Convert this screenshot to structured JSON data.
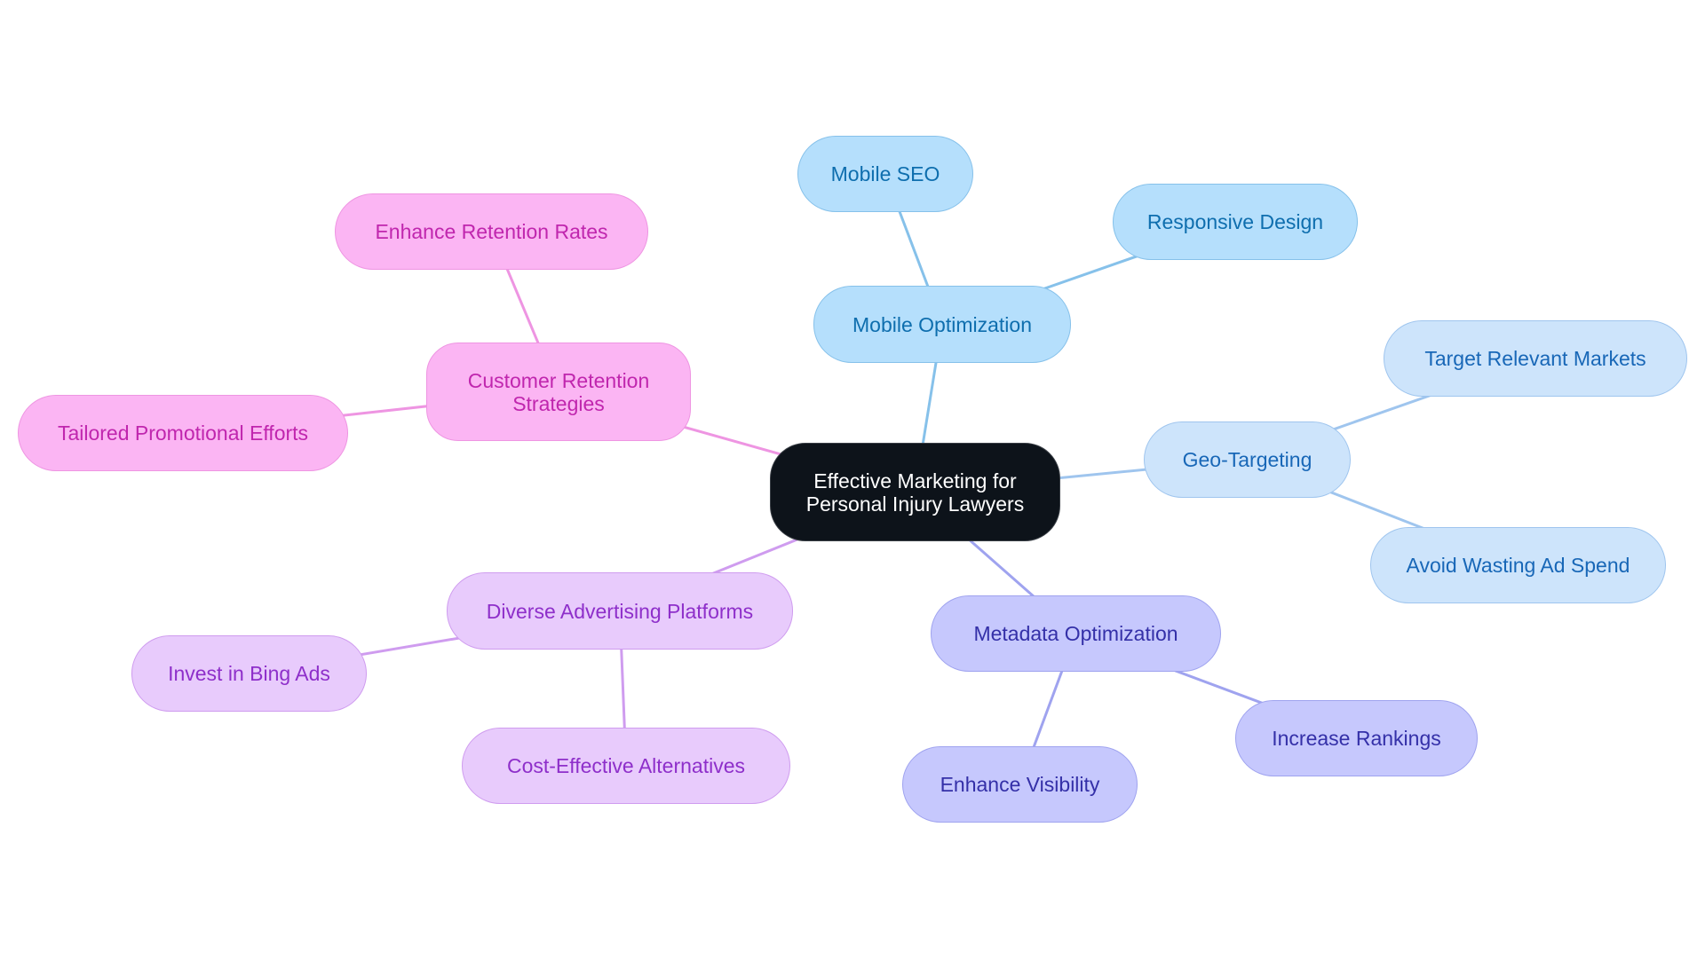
{
  "root": {
    "label": "Effective Marketing for\nPersonal Injury Lawyers",
    "color": "#0d131a"
  },
  "branches": [
    {
      "id": "mobile",
      "label": "Mobile Optimization",
      "color": "#86c1ea",
      "children": [
        {
          "id": "mobile-seo",
          "label": "Mobile SEO"
        },
        {
          "id": "responsive-design",
          "label": "Responsive Design"
        }
      ]
    },
    {
      "id": "geo",
      "label": "Geo-Targeting",
      "color": "#9fc5ee",
      "children": [
        {
          "id": "target-markets",
          "label": "Target Relevant Markets"
        },
        {
          "id": "avoid-waste",
          "label": "Avoid Wasting Ad Spend"
        }
      ]
    },
    {
      "id": "metadata",
      "label": "Metadata Optimization",
      "color": "#9fa3ef",
      "children": [
        {
          "id": "increase-rankings",
          "label": "Increase Rankings"
        },
        {
          "id": "enhance-visibility",
          "label": "Enhance Visibility"
        }
      ]
    },
    {
      "id": "advertising",
      "label": "Diverse Advertising Platforms",
      "color": "#cf9cef",
      "children": [
        {
          "id": "bing-ads",
          "label": "Invest in Bing Ads"
        },
        {
          "id": "cost-effective",
          "label": "Cost-Effective Alternatives"
        }
      ]
    },
    {
      "id": "retention",
      "label": "Customer Retention\nStrategies",
      "color": "#ee95e2",
      "children": [
        {
          "id": "retention-rates",
          "label": "Enhance Retention Rates"
        },
        {
          "id": "promotional",
          "label": "Tailored Promotional Efforts"
        }
      ]
    }
  ]
}
